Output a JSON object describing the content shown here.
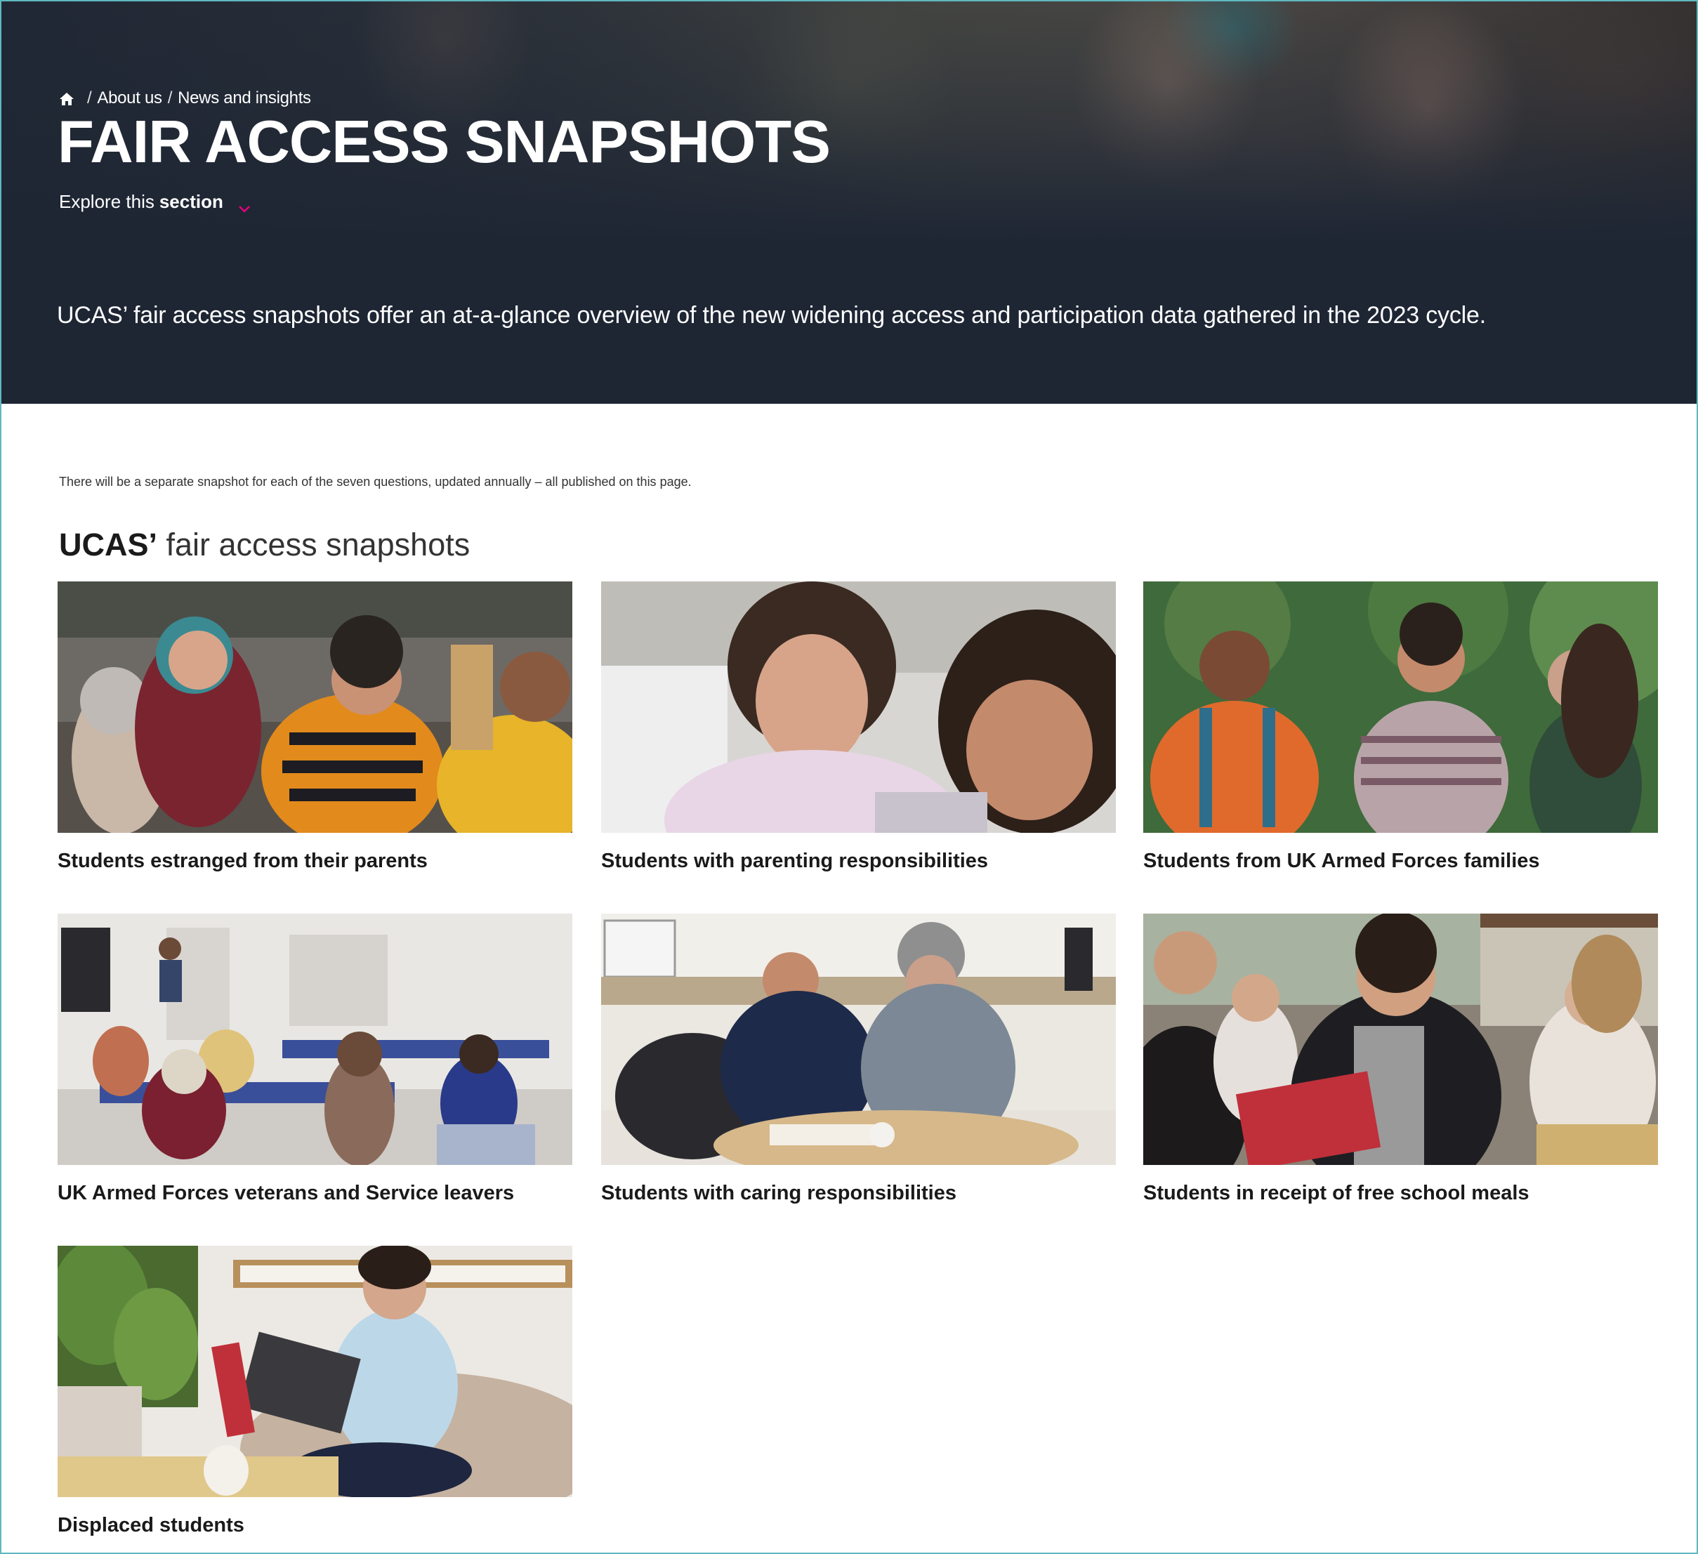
{
  "breadcrumb": {
    "home_icon": "home-icon",
    "items": [
      "About us",
      "News and insights"
    ],
    "separator": "/"
  },
  "hero": {
    "title": "FAIR ACCESS SNAPSHOTS",
    "explore_prefix": "Explore this",
    "explore_bold": "section",
    "explore_icon": "chevron-down-icon",
    "intro": "UCAS’ fair access snapshots offer an at-a-glance overview of the new widening access and participation data gathered in the 2023 cycle.",
    "background_color": "#1e2634"
  },
  "main": {
    "note": "There will be a separate snapshot for each of the seven questions, updated annually – all published on this page.",
    "heading_bold": "UCAS’",
    "heading_light": " fair access snapshots",
    "cards": [
      {
        "label": "Students estranged from their parents"
      },
      {
        "label": "Students with parenting responsibilities"
      },
      {
        "label": "Students from UK Armed Forces families"
      },
      {
        "label": "UK Armed Forces veterans and Service leavers"
      },
      {
        "label": "Students with caring responsibilities"
      },
      {
        "label": "Students in receipt of free school meals"
      },
      {
        "label": "Displaced students"
      }
    ]
  },
  "colors": {
    "accent": "#e6007e",
    "frame_border": "#5fb8c0",
    "text": "#1a1a1a"
  }
}
